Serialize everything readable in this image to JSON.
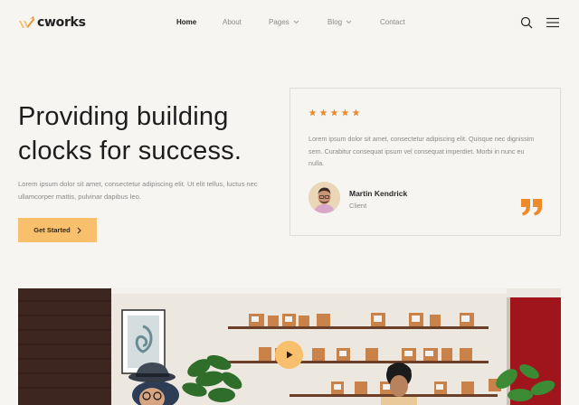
{
  "brand": {
    "name": "cworks",
    "accent": "#f8bf6c",
    "accent_dark": "#ef8a2c"
  },
  "nav": {
    "items": [
      {
        "label": "Home",
        "active": true
      },
      {
        "label": "About",
        "active": false
      },
      {
        "label": "Pages",
        "active": false,
        "has_dropdown": true
      },
      {
        "label": "Blog",
        "active": false,
        "has_dropdown": true
      },
      {
        "label": "Contact",
        "active": false
      }
    ],
    "icons": [
      "search-icon",
      "menu-icon"
    ]
  },
  "hero": {
    "title": "Providing building clocks for success.",
    "description": "Lorem ipsum dolor sit amet, consectetur adipiscing elit. Ut elit tellus, luctus nec ullamcorper mattis, pulvinar dapibus leo.",
    "cta_label": "Get Started"
  },
  "testimonial": {
    "rating": 5,
    "text": "Lorem ipsum dolor sit amet, consectetur adipiscing elit. Quisque nec dignissim sem. Curabitur consequat ipsum vel consequat imperdiet. Morbi in nunc eu nulla.",
    "author_name": "Martin Kendrick",
    "author_role": "Client"
  },
  "media": {
    "icon": "play-icon"
  }
}
